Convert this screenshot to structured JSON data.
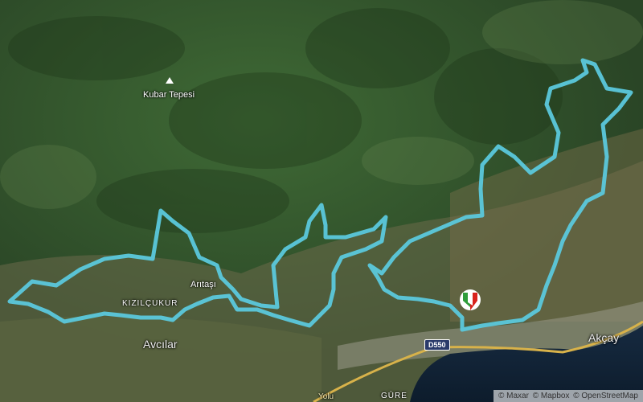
{
  "map": {
    "peak": {
      "name": "Kubar Tepesi",
      "icon": "mountain-peak-icon"
    },
    "places": {
      "aritasi": "Arıtaşı",
      "kizilcukur": "KIZILÇUKUR",
      "avcilar": "Avcılar",
      "akcay": "Akçay",
      "gure": "GÜRE",
      "road_partial": "Yolu"
    },
    "road_label": "D550",
    "route_color": "#5bc8dc",
    "marker": {
      "icon": "start-finish-flag-icon",
      "colors": [
        "#d9221c",
        "#2f9c3a",
        "#ffffff"
      ]
    },
    "attribution": {
      "maxar": "© Maxar",
      "mapbox": "© Mapbox",
      "osm": "© OpenStreetMap"
    }
  }
}
